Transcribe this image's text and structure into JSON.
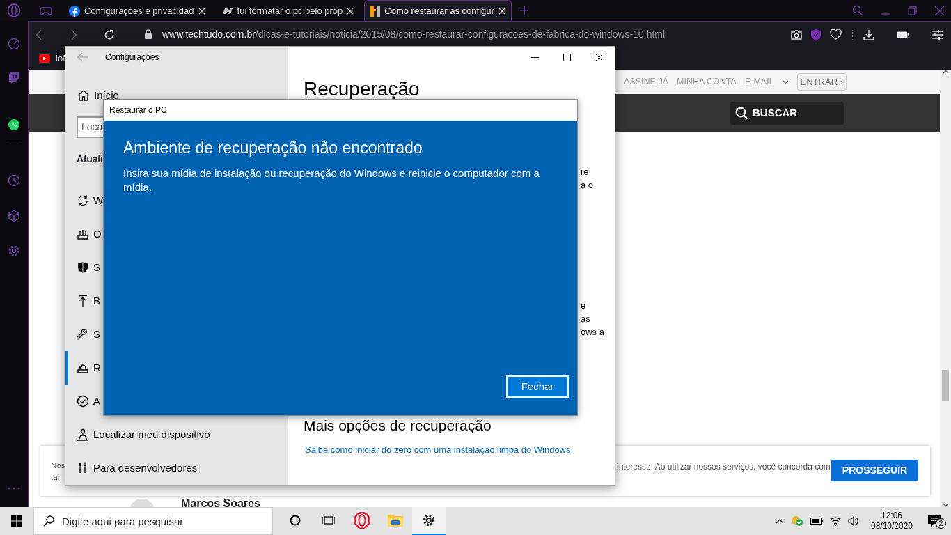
{
  "browser": {
    "tabs": [
      {
        "kind": "game",
        "selected": false
      },
      {
        "kind": "facebook",
        "label": "Configurações e privacidad",
        "selected": false
      },
      {
        "kind": "forum",
        "label": "fui formatar o pc pelo próp",
        "selected": false
      },
      {
        "kind": "techtudo",
        "label": "Como restaurar as configur",
        "selected": true
      }
    ],
    "address": {
      "domain": "www.techtudo.com.br",
      "path": "/dicas-e-tutoriais/noticia/2015/08/como-restaurar-configuracoes-de-fabrica-do-windows-10.html"
    },
    "bookmarks": [
      {
        "label": "lof"
      }
    ]
  },
  "webpage": {
    "header_links": [
      "ASSINE JÁ",
      "MINHA CONTA",
      "E-MAIL"
    ],
    "login_button": "ENTRAR ›",
    "search_button": "BUSCAR",
    "cookie_banner": {
      "lines": [
        "Nós",
        "tal"
      ],
      "text": "interesse. Ao utilizar nossos serviços, você concorda com",
      "button": "PROSSEGUIR"
    },
    "author": "Marcos Soares"
  },
  "settings": {
    "title": "Configurações",
    "home": "Início",
    "search": {
      "placeholder": "Loca"
    },
    "section": "Atuali",
    "nav": [
      {
        "label": "W",
        "selected": false
      },
      {
        "label": "O",
        "selected": false
      },
      {
        "label": "S",
        "selected": false
      },
      {
        "label": "B",
        "selected": false
      },
      {
        "label": "S",
        "selected": false
      },
      {
        "label": "R",
        "selected": true
      },
      {
        "label": "A",
        "selected": false
      },
      {
        "label": "Localizar meu dispositivo",
        "selected": false
      },
      {
        "label": "Para desenvolvedores",
        "selected": false
      }
    ],
    "heading": "Recuperação",
    "paragraphs": [
      {
        "lines": [
          "re",
          "a o"
        ]
      },
      {
        "lines": [
          "e",
          "as",
          "ows a"
        ]
      }
    ],
    "subheading": "Mais opções de recuperação",
    "link": "Saiba como iniciar do zero com uma instalação limpa do Windows"
  },
  "dialog": {
    "title": "Restaurar o PC",
    "heading": "Ambiente de recuperação não encontrado",
    "message": "Insira sua mídia de instalação ou recuperação do Windows e reinicie o computador com a mídia.",
    "button": "Fechar"
  },
  "taskbar": {
    "search": {
      "placeholder": "Digite aqui para pesquisar"
    },
    "apps": [
      {
        "kind": "cortana",
        "selected": false
      },
      {
        "kind": "taskview",
        "selected": false
      },
      {
        "kind": "opera",
        "selected": false
      },
      {
        "kind": "explorer",
        "selected": false
      },
      {
        "kind": "settings",
        "selected": true
      }
    ],
    "time": "12:06",
    "date": "08/10/2020",
    "notifications": "2"
  }
}
